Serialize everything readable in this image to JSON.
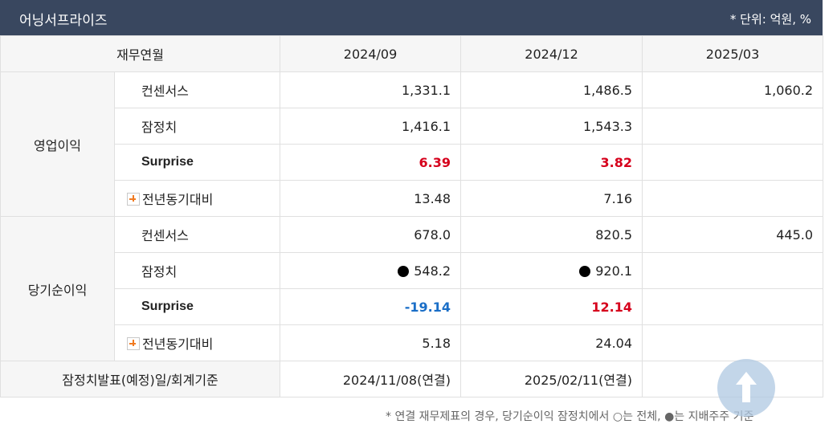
{
  "header": {
    "title": "어닝서프라이즈",
    "unit": "* 단위: 억원, %"
  },
  "columns": {
    "label": "재무연월",
    "periods": [
      "2024/09",
      "2024/12",
      "2025/03"
    ]
  },
  "operating": {
    "group_label": "영업이익",
    "rows": [
      {
        "label": "컨센서스",
        "values": [
          "1,331.1",
          "1,486.5",
          "1,060.2"
        ]
      },
      {
        "label": "잠정치",
        "values": [
          "1,416.1",
          "1,543.3",
          ""
        ]
      },
      {
        "label": "Surprise",
        "values": [
          "6.39",
          "3.82",
          ""
        ]
      },
      {
        "label": "전년동기대비",
        "values": [
          "13.48",
          "7.16",
          ""
        ]
      }
    ]
  },
  "net": {
    "group_label": "당기순이익",
    "rows": [
      {
        "label": "컨센서스",
        "values": [
          "678.0",
          "820.5",
          "445.0"
        ]
      },
      {
        "label": "잠정치",
        "values": [
          "548.2",
          "920.1",
          ""
        ]
      },
      {
        "label": "Surprise",
        "values": [
          "-19.14",
          "12.14",
          ""
        ]
      },
      {
        "label": "전년동기대비",
        "values": [
          "5.18",
          "24.04",
          ""
        ]
      }
    ]
  },
  "announce": {
    "label": "잠정치발표(예정)일/회계기준",
    "values": [
      "2024/11/08(연결)",
      "2025/02/11(연결)",
      ""
    ]
  },
  "footer": {
    "note": "* 연결 재무제표의 경우, 당기순이익 잠정치에서 ○는 전체, ●는 지배주주 기준"
  },
  "icons": {
    "expand": "plus-icon",
    "indicator": "filled-circle-icon",
    "scroll_top": "arrow-up-icon"
  },
  "colors": {
    "header_bg": "#39475f",
    "positive": "#d6001c",
    "negative": "#1a6ec7"
  }
}
